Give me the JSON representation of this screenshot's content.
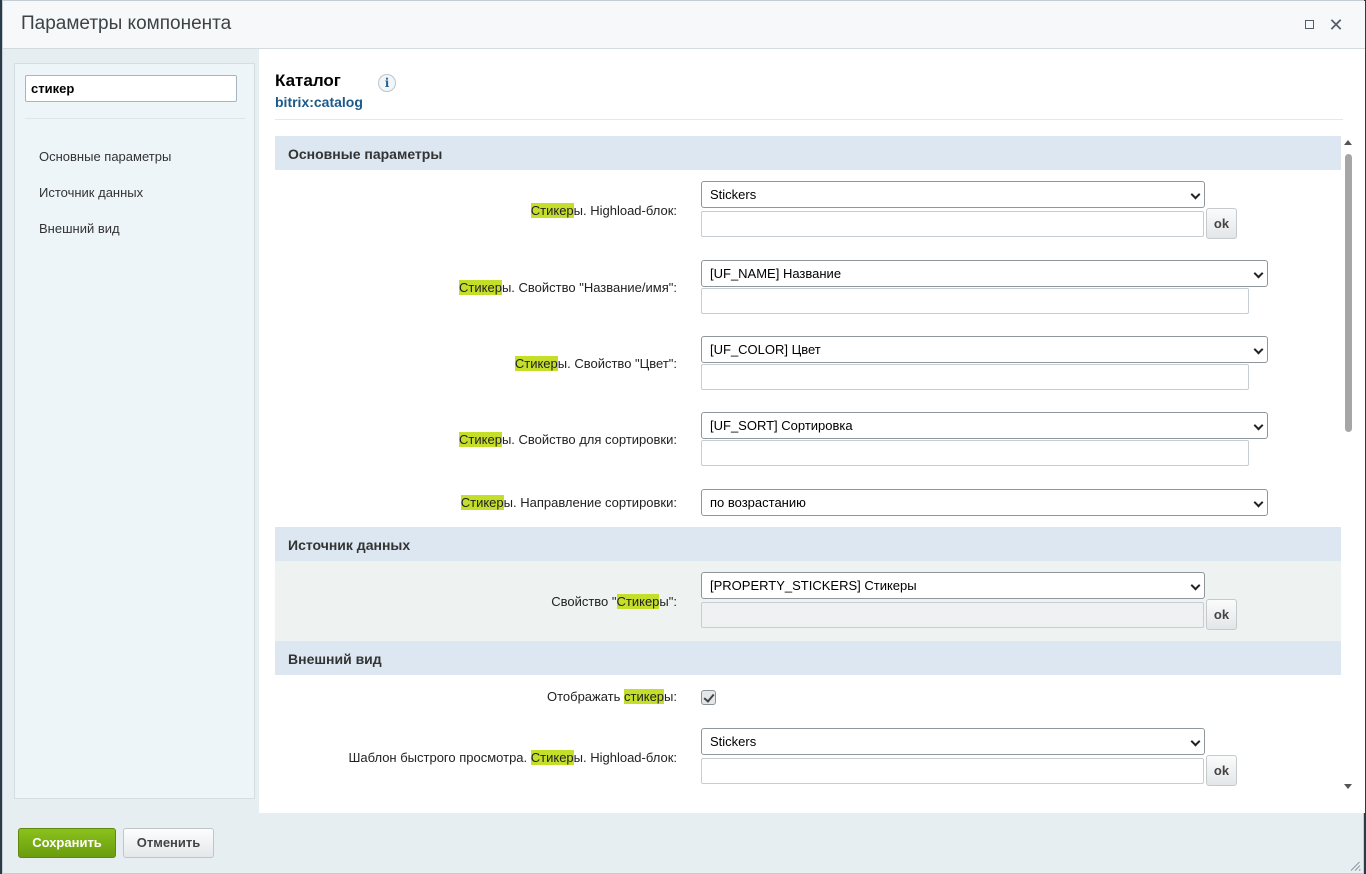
{
  "window": {
    "title": "Параметры компонента",
    "maximize_label": "",
    "close_label": "✕"
  },
  "sidebar": {
    "search_value": "стикер",
    "items": [
      {
        "label": "Основные параметры"
      },
      {
        "label": "Источник данных"
      },
      {
        "label": "Внешний вид"
      }
    ]
  },
  "component": {
    "title": "Каталог",
    "code": "bitrix:catalog",
    "info_icon": "i"
  },
  "sections": {
    "basic": {
      "title": "Основные параметры"
    },
    "source": {
      "title": "Источник данных"
    },
    "view": {
      "title": "Внешний вид"
    }
  },
  "highlight_color": "#c4de29",
  "params": {
    "hlblock": {
      "pre": "",
      "hl": "Стикер",
      "post": "ы. Highload-блок:",
      "value": "Stickers",
      "ok": "ok"
    },
    "name_prop": {
      "pre": "",
      "hl": "Стикер",
      "post": "ы. Свойство \"Название/имя\":",
      "value": "[UF_NAME] Название"
    },
    "color_prop": {
      "pre": "",
      "hl": "Стикер",
      "post": "ы. Свойство \"Цвет\":",
      "value": "[UF_COLOR] Цвет"
    },
    "sort_prop": {
      "pre": "",
      "hl": "Стикер",
      "post": "ы. Свойство для сортировки:",
      "value": "[UF_SORT] Сортировка"
    },
    "sort_dir": {
      "pre": "",
      "hl": "Стикер",
      "post": "ы. Направление сортировки:",
      "value": "по возрастанию"
    },
    "property": {
      "pre": "Свойство \"",
      "hl": "Стикер",
      "post": "ы\":",
      "value": "[PROPERTY_STICKERS] Стикеры",
      "ok": "ok"
    },
    "show": {
      "pre": "Отображать ",
      "hl": "стикер",
      "post": "ы:",
      "checked": true
    },
    "quick_view": {
      "pre": "Шаблон быстрого просмотра. ",
      "hl": "Стикер",
      "post": "ы. Highload-блок:",
      "value": "Stickers",
      "ok": "ok"
    }
  },
  "footer": {
    "save_label": "Сохранить",
    "cancel_label": "Отменить"
  }
}
